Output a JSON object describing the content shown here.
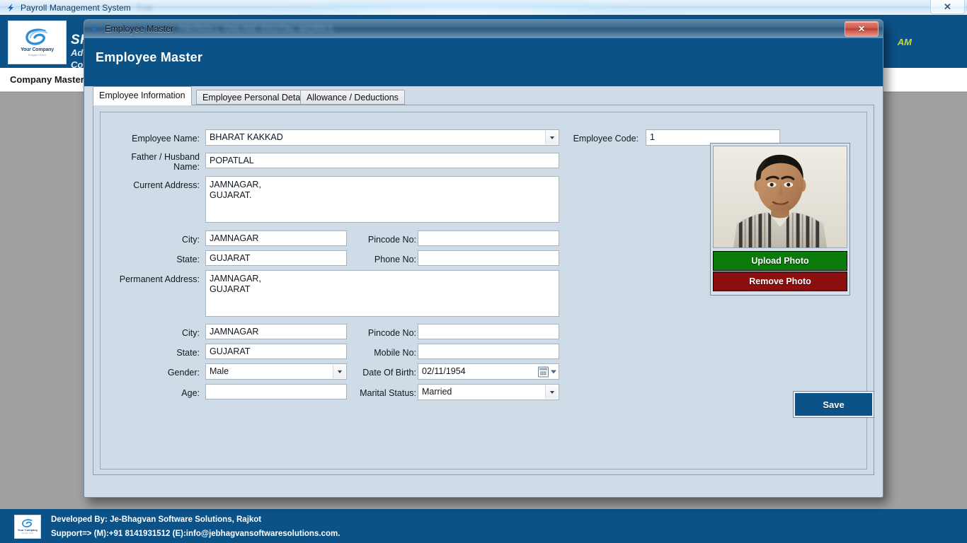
{
  "app_window": {
    "title": "Payroll Management System",
    "title_suffix_blurred": "Trial",
    "close_label": "✕",
    "clock": "AM",
    "logo": {
      "name_part1": "Your ",
      "name_part2": "Company",
      "tagline": "Slogan Here"
    },
    "company": {
      "name": "SH",
      "line2": "Ad",
      "line3": "Co"
    },
    "menu": [
      {
        "label": "Company Master"
      }
    ]
  },
  "footer": {
    "line1": "Developed By: Je-Bhagvan Software Solutions, Rajkot",
    "line2": "Support=> (M):+91 8141931512 (E):info@jebhagvansoftwaresolutions.com.",
    "logo_name": "Your Company",
    "logo_tag": "Slogan Here"
  },
  "dialog": {
    "titlebar_text": "Employee Master",
    "titlebar_blurred": "PAYROLL ONLINE DIGITAL WORKS",
    "close_label": "✕",
    "header_title": "Employee Master",
    "tabs": [
      {
        "label": "Employee Information",
        "active": true
      },
      {
        "label": "Employee Personal Details",
        "active": false
      },
      {
        "label": "Allowance / Deductions",
        "active": false
      }
    ],
    "save_label": "Save"
  },
  "form": {
    "employee_name": {
      "label": "Employee Name:",
      "value": "BHARAT KAKKAD",
      "type": "combobox"
    },
    "father_husband_name": {
      "label": "Father / Husband Name:",
      "label_line1": "Father / Husband",
      "label_line2": "Name:",
      "value": "POPATLAL"
    },
    "current_address": {
      "label": "Current Address:",
      "value": "JAMNAGAR,\nGUJARAT."
    },
    "current_city": {
      "label": "City:",
      "value": "JAMNAGAR"
    },
    "current_pincode": {
      "label": "Pincode No:",
      "value": ""
    },
    "current_state": {
      "label": "State:",
      "value": "GUJARAT"
    },
    "phone_no": {
      "label": "Phone No:",
      "value": ""
    },
    "permanent_address": {
      "label": "Permanent Address:",
      "value": "JAMNAGAR,\nGUJARAT"
    },
    "permanent_city": {
      "label": "City:",
      "value": "JAMNAGAR"
    },
    "permanent_pincode": {
      "label": "Pincode No:",
      "value": ""
    },
    "permanent_state": {
      "label": "State:",
      "value": "GUJARAT"
    },
    "mobile_no": {
      "label": "Mobile No:",
      "value": ""
    },
    "gender": {
      "label": "Gender:",
      "value": "Male",
      "type": "combobox"
    },
    "date_of_birth": {
      "label": "Date Of Birth:",
      "value": "02/11/1954",
      "type": "datepicker"
    },
    "age": {
      "label": "Age:",
      "value": ""
    },
    "marital_status": {
      "label": "Marital Status:",
      "value": "Married",
      "type": "combobox"
    },
    "employee_code": {
      "label": "Employee Code:",
      "value": "1"
    }
  },
  "photo": {
    "upload_label": "Upload Photo",
    "remove_label": "Remove Photo",
    "upload_color": "#0a7a0a",
    "remove_color": "#8b0f0f",
    "alt": "employee-photo"
  },
  "colors": {
    "brand_blue": "#0b5288",
    "dialog_bg": "#cfdce8",
    "desktop_gray": "#a0a0a0"
  }
}
